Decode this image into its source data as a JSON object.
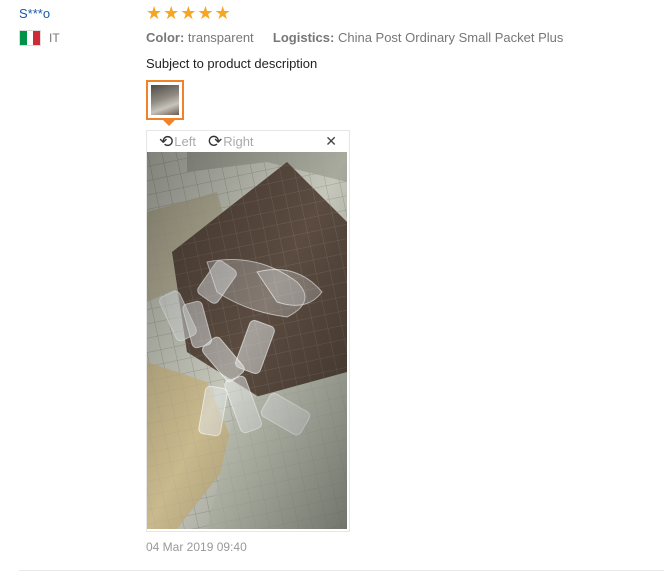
{
  "user": {
    "name": "S***o",
    "country_code": "IT",
    "flag_colors": [
      "#009246",
      "#ffffff",
      "#ce2b37"
    ]
  },
  "review": {
    "rating": 5,
    "star_icon": "star-icon",
    "color_label": "Color:",
    "color_value": "transparent",
    "logistics_label": "Logistics:",
    "logistics_value": "China Post Ordinary Small Packet Plus",
    "text": "Subject to product description",
    "date": "04 Mar 2019 09:40"
  },
  "viewer": {
    "rotate_left_label": "Left",
    "rotate_right_label": "Right",
    "close_icon": "close-icon",
    "rotate_left_icon": "rotate-left-icon",
    "rotate_right_icon": "rotate-right-icon"
  },
  "colors": {
    "accent": "#f0832a",
    "star": "#f5a623",
    "username": "#1b5aa6"
  }
}
